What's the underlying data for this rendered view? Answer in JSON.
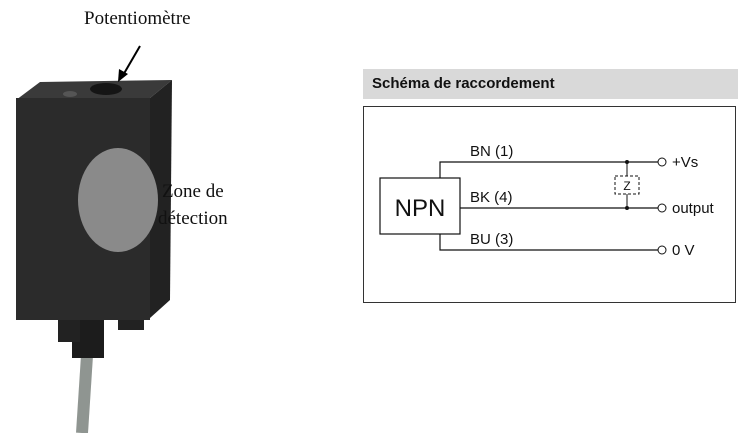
{
  "photo": {
    "potentiometer_label": "Potentiomètre",
    "zone_label_line1": "Zone de",
    "zone_label_line2": "détection"
  },
  "schema": {
    "title": "Schéma de raccordement",
    "transistor": "NPN",
    "wires": [
      {
        "label": "BN (1)",
        "terminal": "+Vs"
      },
      {
        "label": "BK (4)",
        "terminal": "output"
      },
      {
        "label": "BU (3)",
        "terminal": "0 V"
      }
    ],
    "load_label": "Z"
  },
  "colors": {
    "header_bg": "#d9d9d9",
    "sensor_body": "#2b2b2b",
    "detection_disc": "#8a8a8a"
  }
}
